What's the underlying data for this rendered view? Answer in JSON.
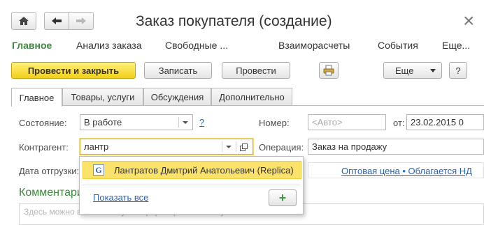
{
  "window": {
    "title": "Заказ покупателя (создание)",
    "close_glyph": "×"
  },
  "sections": {
    "main": "Главное",
    "analysis": "Анализ заказа",
    "free": "Свободные ...",
    "settlements": "Взаиморасчеты",
    "events": "События",
    "more": "Еще..."
  },
  "commands": {
    "post_and_close": "Провести и закрыть",
    "save": "Записать",
    "post": "Провести",
    "more": "Еще",
    "help": "?"
  },
  "tabs": [
    {
      "label": "Главное",
      "active": true
    },
    {
      "label": "Товары, услуги",
      "active": false
    },
    {
      "label": "Обсуждения",
      "active": false
    },
    {
      "label": "Дополнительно",
      "active": false
    }
  ],
  "form": {
    "status_label": "Состояние:",
    "status_value": "В работе",
    "status_help": "?",
    "number_label": "Номер:",
    "number_placeholder": "<Авто>",
    "date_label": "от:",
    "date_value": "23.02.2015  0",
    "counterparty_label": "Контрагент:",
    "counterparty_value": "лантр",
    "operation_label": "Операция:",
    "operation_value": "Заказ на продажу",
    "shipment_label": "Дата отгрузки:",
    "price_link": "Оптовая цена • Облагается НД"
  },
  "comments": {
    "title": "Комментарий",
    "placeholder": "Здесь можно ввести любую информацию по заказу"
  },
  "popup": {
    "item_icon": "G",
    "item_text": "Лантратов Дмитрий Анатольевич (Replica)",
    "show_all": "Показать все",
    "add_glyph": "+"
  },
  "colors": {
    "accent_green": "#3b8a3b",
    "primary_yellow": "#f2cf1a",
    "link_blue": "#2a62b5",
    "highlight": "#fbe26a"
  }
}
